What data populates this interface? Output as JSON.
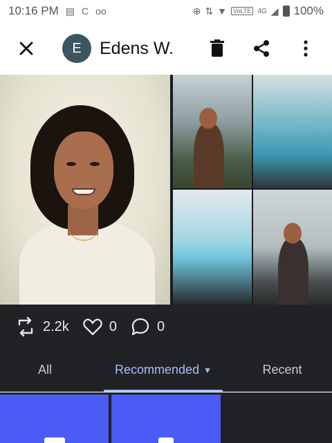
{
  "status_bar": {
    "time": "10:16 PM",
    "left_icons": [
      "notification-card-icon",
      "sync-c-icon",
      "voicemail-icon"
    ],
    "volte": "VoLTE",
    "network": "4G",
    "battery": "100%"
  },
  "header": {
    "avatar_letter": "E",
    "username": "Edens W.",
    "icons": [
      "close-icon",
      "delete-icon",
      "share-icon",
      "more-vert-icon"
    ]
  },
  "post": {
    "images": [
      "portrait",
      "woman-on-cliff",
      "blue-lagoon",
      "iceberg-beach",
      "woman-black-sand-beach"
    ]
  },
  "stats": {
    "reposts": "2.2k",
    "likes": "0",
    "comments": "0"
  },
  "tabs": [
    {
      "label": "All",
      "active": false
    },
    {
      "label": "Recommended",
      "active": true
    },
    {
      "label": "Recent",
      "active": false
    }
  ],
  "colors": {
    "accent": "#a9bdf8",
    "tile": "#4a5cf5",
    "dark_bg": "#202226",
    "avatar_bg": "#3c5563"
  }
}
